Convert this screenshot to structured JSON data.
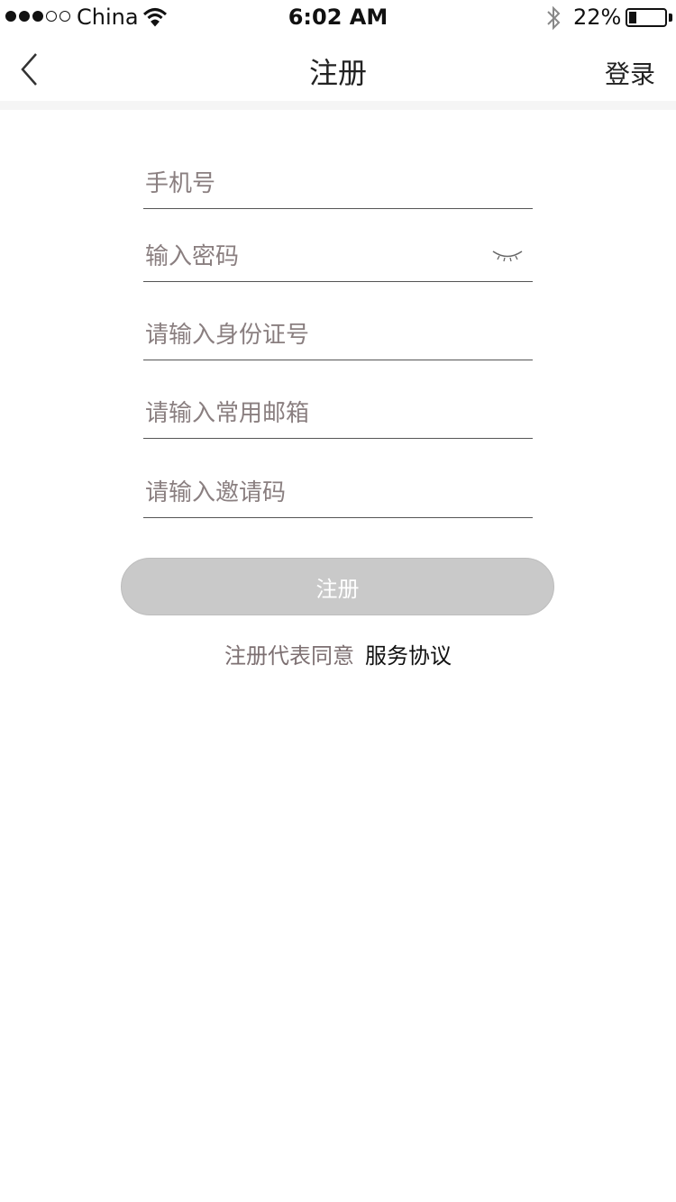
{
  "status_bar": {
    "carrier": "China",
    "time": "6:02 AM",
    "battery": "22%",
    "battery_level": 0.22,
    "signal_bars": 3,
    "signal_total": 5
  },
  "nav": {
    "title": "注册",
    "right_link": "登录",
    "back_icon": "chevron-left-icon"
  },
  "form": {
    "phone_placeholder": "手机号",
    "password_placeholder": "输入密码",
    "id_placeholder": "请输入身份证号",
    "email_placeholder": "请输入常用邮箱",
    "invite_placeholder": "请输入邀请码",
    "password_toggle_icon": "eye-closed-icon",
    "submit_label": "注册"
  },
  "agreement": {
    "prefix": "注册代表同意",
    "link": "服务协议"
  },
  "colors": {
    "button_bg": "#c9c9c9",
    "placeholder": "#8a7f80",
    "divider_band": "#f5f5f5"
  }
}
